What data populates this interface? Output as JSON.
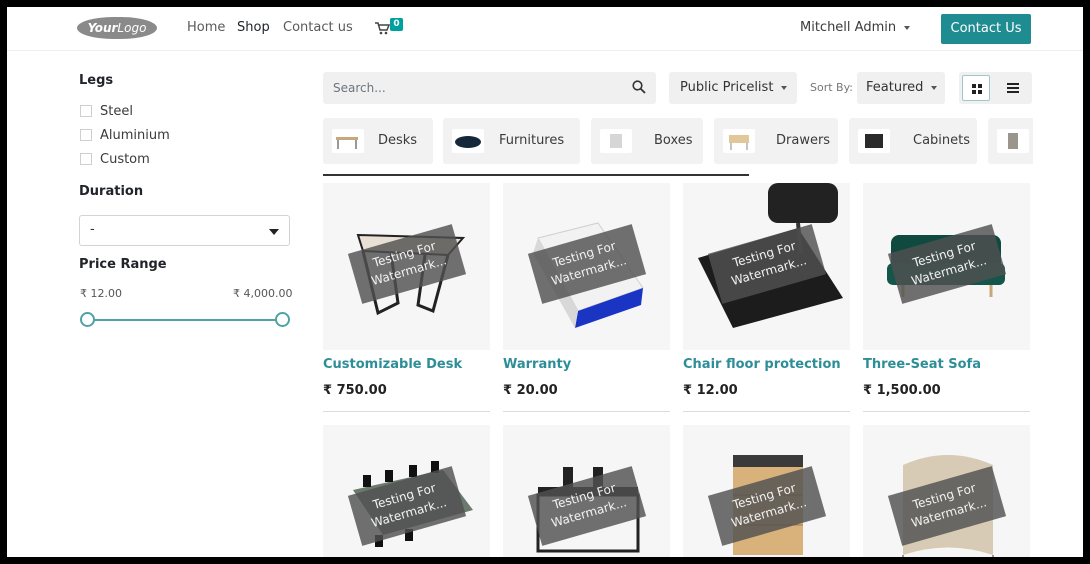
{
  "header": {
    "logo": {
      "bold": "Your",
      "light": "Logo"
    },
    "nav": [
      {
        "label": "Home"
      },
      {
        "label": "Shop"
      },
      {
        "label": "Contact us"
      }
    ],
    "cart_count": "0",
    "user": "Mitchell Admin",
    "contact_button": "Contact Us"
  },
  "sidebar": {
    "legs_title": "Legs",
    "legs_options": [
      "Steel",
      "Aluminium",
      "Custom"
    ],
    "duration_title": "Duration",
    "duration_value": "-",
    "price_title": "Price Range",
    "price_min": "₹ 12.00",
    "price_max": "₹ 4,000.00",
    "slider_range": [
      0,
      1
    ]
  },
  "toolbar": {
    "search_placeholder": "Search...",
    "pricelist": "Public Pricelist",
    "sort_label": "Sort By:",
    "sort_value": "Featured"
  },
  "categories": [
    "Desks",
    "Furnitures",
    "Boxes",
    "Drawers",
    "Cabinets"
  ],
  "watermark": {
    "line1": "Testing For",
    "line2": "Watermark..."
  },
  "products": [
    {
      "name": "Customizable Desk",
      "price": "₹ 750.00"
    },
    {
      "name": "Warranty",
      "price": "₹ 20.00"
    },
    {
      "name": "Chair floor protection",
      "price": "₹ 12.00"
    },
    {
      "name": "Three-Seat Sofa",
      "price": "₹ 1,500.00"
    }
  ],
  "colors": {
    "accent": "#1f8c92",
    "product_link": "#2d8e98",
    "corner": "#6f1d4b"
  }
}
